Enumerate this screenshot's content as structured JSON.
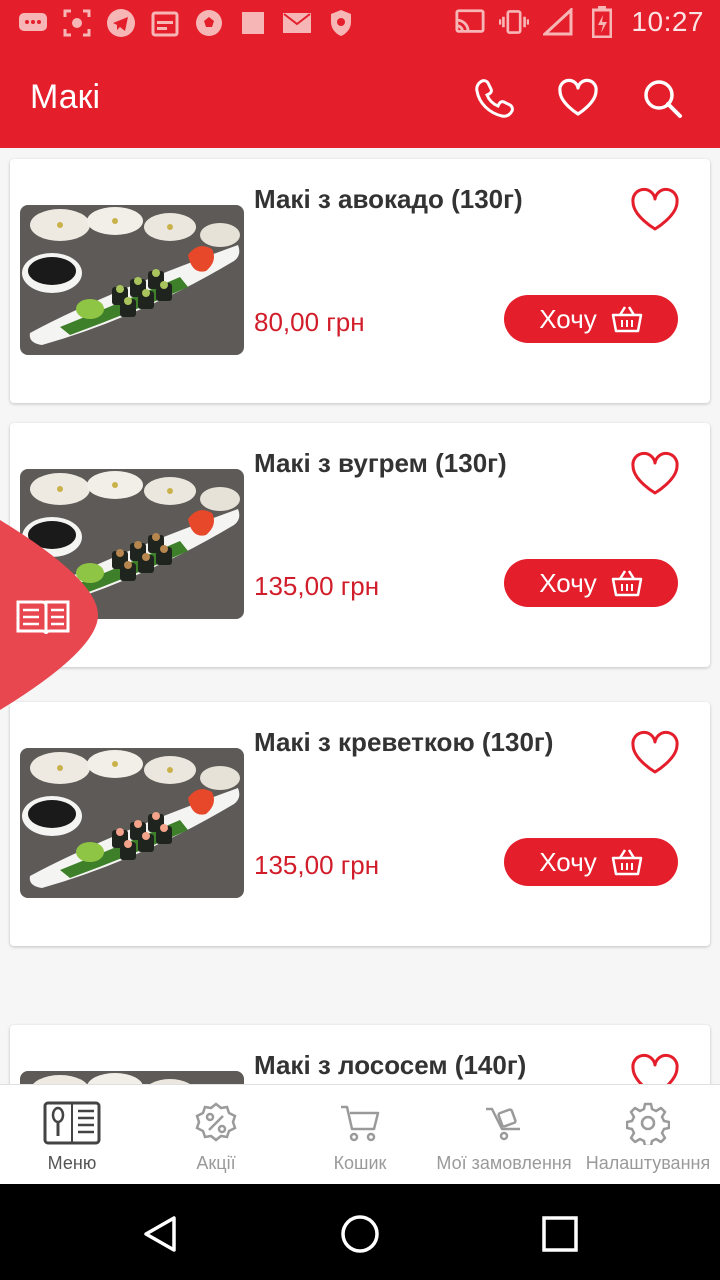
{
  "status": {
    "time": "10:27"
  },
  "appbar": {
    "title": "Макі",
    "phone_icon": "phone-icon",
    "favorites_icon": "heart-icon",
    "search_icon": "search-icon"
  },
  "products": [
    {
      "name": "Макі з авокадо (130г)",
      "price": "80,00 грн",
      "button": "Хочу"
    },
    {
      "name": "Макі з вугрем (130г)",
      "price": "135,00 грн",
      "button": "Хочу"
    },
    {
      "name": "Макі з креветкою (130г)",
      "price": "135,00 грн",
      "button": "Хочу"
    },
    {
      "name": "Макі з лососем (140г)"
    }
  ],
  "nav": [
    {
      "label": "Меню",
      "icon": "menu-book-icon"
    },
    {
      "label": "Акції",
      "icon": "percent-badge-icon"
    },
    {
      "label": "Кошик",
      "icon": "cart-icon"
    },
    {
      "label": "Мої замовлення",
      "icon": "trolley-icon"
    },
    {
      "label": "Налаштування",
      "icon": "gear-icon"
    }
  ],
  "colors": {
    "brand": "#e41e2b",
    "price": "#d11d2a",
    "text": "#333333",
    "nav_inactive": "#9a9a9a"
  }
}
